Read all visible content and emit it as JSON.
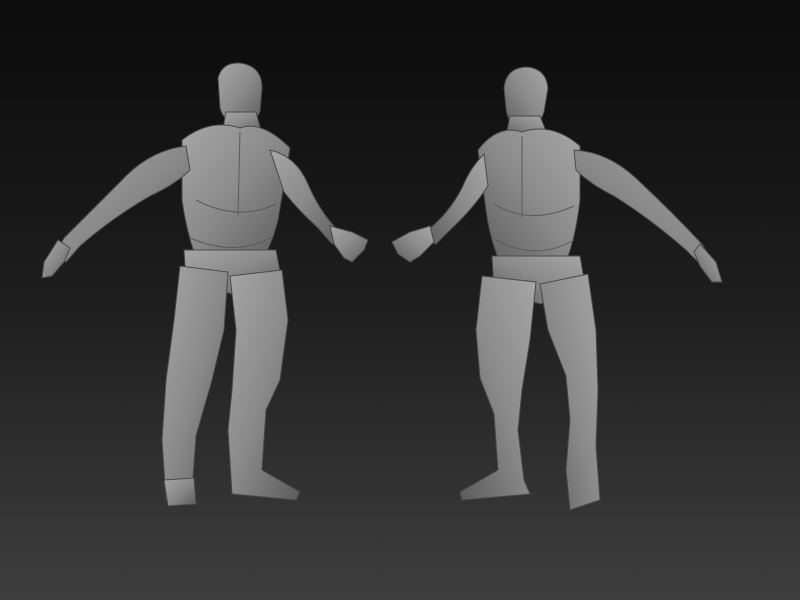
{
  "scene": {
    "background_top": "#0b0b0b",
    "background_bottom": "#3e3e3e",
    "model_color": "#8a8a8a",
    "models": [
      {
        "view": "front-left",
        "facing": "left"
      },
      {
        "view": "front-right",
        "facing": "right"
      }
    ]
  }
}
